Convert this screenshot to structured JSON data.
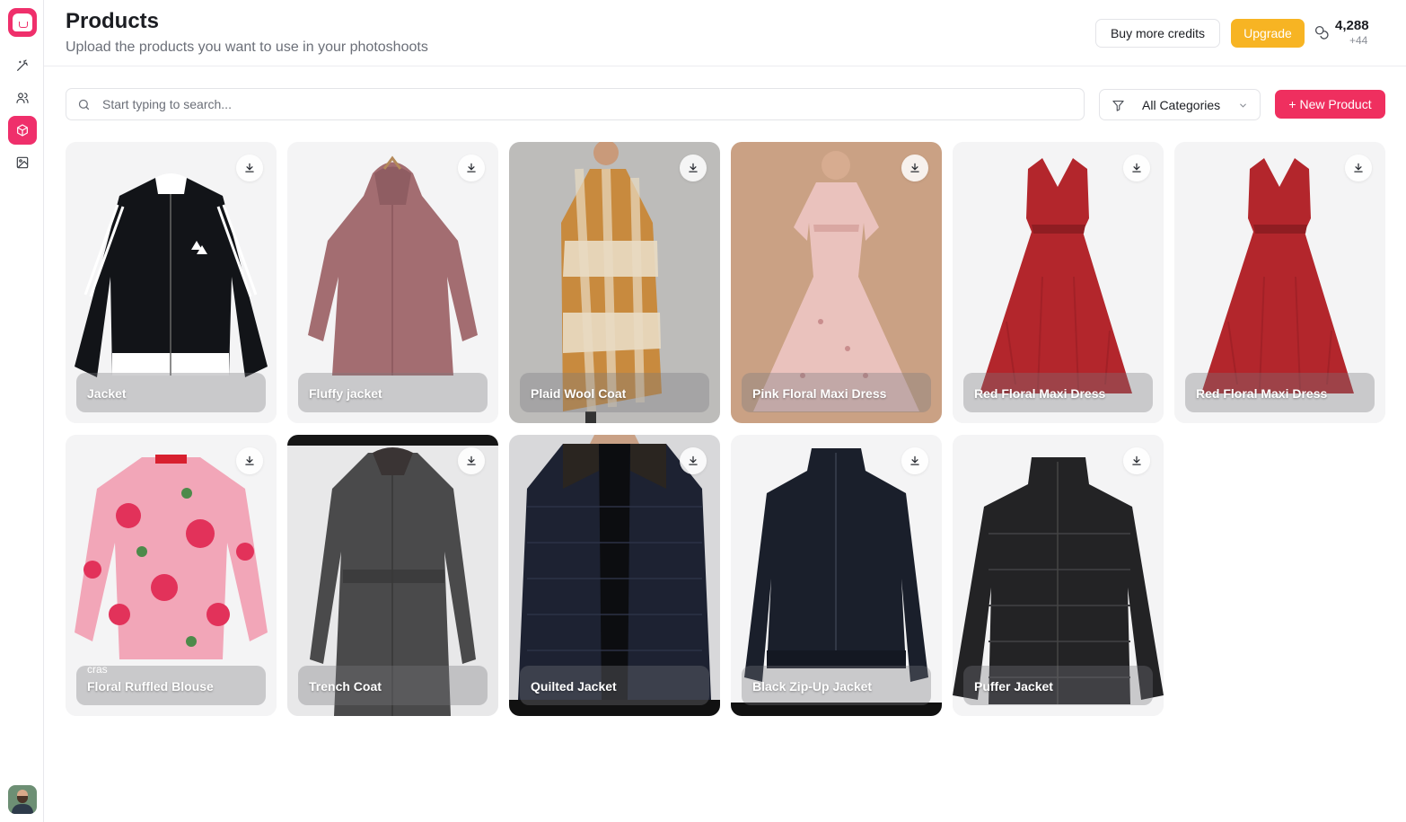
{
  "header": {
    "title": "Products",
    "subtitle": "Upload the products you want to use in your photoshoots",
    "buy_credits_label": "Buy more credits",
    "upgrade_label": "Upgrade",
    "credits_count": "4,288",
    "credits_delta": "+44"
  },
  "toolbar": {
    "search_placeholder": "Start typing to search...",
    "category_selected": "All Categories",
    "new_product_label": "+ New Product"
  },
  "sidebar": {
    "items": [
      {
        "icon": "magic-wand-icon"
      },
      {
        "icon": "users-icon"
      },
      {
        "icon": "box-icon",
        "active": true
      },
      {
        "icon": "image-icon"
      }
    ]
  },
  "colors": {
    "accent": "#ef2f5f",
    "upgrade": "#f7b423"
  },
  "products": [
    {
      "name": "Jacket"
    },
    {
      "name": "Fluffy jacket"
    },
    {
      "name": "Plaid Wool Coat"
    },
    {
      "name": "Pink Floral Maxi Dress"
    },
    {
      "name": "Red Floral Maxi Dress"
    },
    {
      "name": "Red Floral Maxi Dress"
    },
    {
      "name": "Floral Ruffled Blouse",
      "brand": "cras"
    },
    {
      "name": "Trench Coat"
    },
    {
      "name": "Quilted Jacket"
    },
    {
      "name": "Black Zip-Up Jacket"
    },
    {
      "name": "Puffer Jacket"
    }
  ]
}
